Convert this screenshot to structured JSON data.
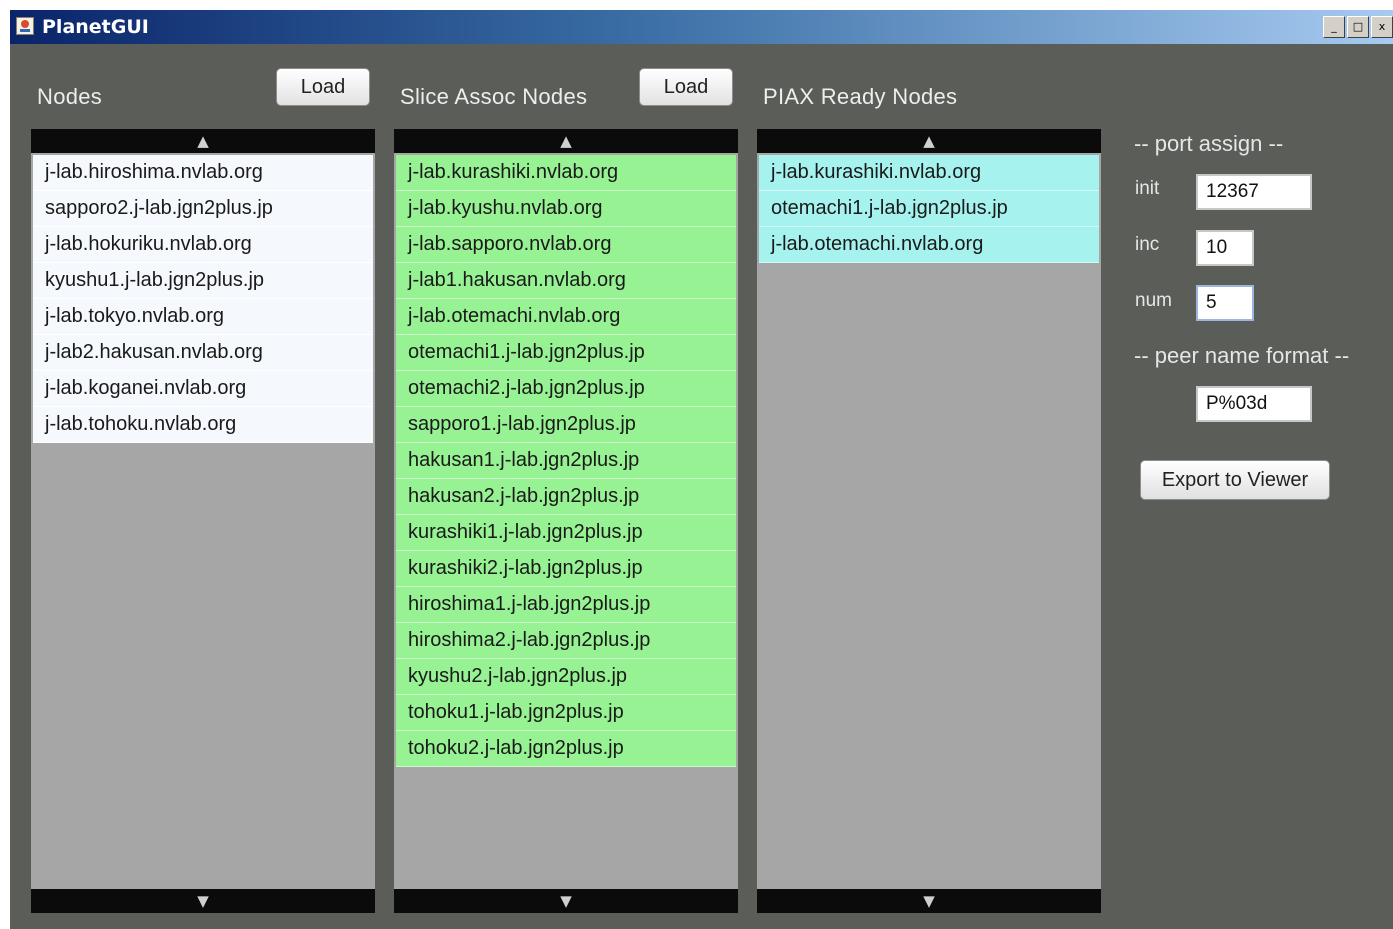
{
  "window": {
    "title": "PlanetGUI",
    "controls": [
      "_",
      "□",
      "x"
    ]
  },
  "nodes": {
    "label": "Nodes",
    "load_label": "Load",
    "items": [
      "j-lab.hiroshima.nvlab.org",
      "sapporo2.j-lab.jgn2plus.jp",
      "j-lab.hokuriku.nvlab.org",
      "kyushu1.j-lab.jgn2plus.jp",
      "j-lab.tokyo.nvlab.org",
      "j-lab2.hakusan.nvlab.org",
      "j-lab.koganei.nvlab.org",
      "j-lab.tohoku.nvlab.org"
    ]
  },
  "slice": {
    "label": "Slice Assoc Nodes",
    "load_label": "Load",
    "items": [
      "j-lab.kurashiki.nvlab.org",
      "j-lab.kyushu.nvlab.org",
      "j-lab.sapporo.nvlab.org",
      "j-lab1.hakusan.nvlab.org",
      "j-lab.otemachi.nvlab.org",
      "otemachi1.j-lab.jgn2plus.jp",
      "otemachi2.j-lab.jgn2plus.jp",
      "sapporo1.j-lab.jgn2plus.jp",
      "hakusan1.j-lab.jgn2plus.jp",
      "hakusan2.j-lab.jgn2plus.jp",
      "kurashiki1.j-lab.jgn2plus.jp",
      "kurashiki2.j-lab.jgn2plus.jp",
      "hiroshima1.j-lab.jgn2plus.jp",
      "hiroshima2.j-lab.jgn2plus.jp",
      "kyushu2.j-lab.jgn2plus.jp",
      "tohoku1.j-lab.jgn2plus.jp",
      "tohoku2.j-lab.jgn2plus.jp"
    ]
  },
  "piax": {
    "label": "PIAX Ready Nodes",
    "items": [
      "j-lab.kurashiki.nvlab.org",
      "otemachi1.j-lab.jgn2plus.jp",
      "j-lab.otemachi.nvlab.org"
    ]
  },
  "scroll": {
    "up": "▲",
    "down": "▼"
  },
  "port_assign": {
    "heading": "-- port assign --",
    "init_label": "init",
    "init_value": "12367",
    "inc_label": "inc",
    "inc_value": "10",
    "num_label": "num",
    "num_value": "5"
  },
  "peer_name": {
    "heading": "-- peer name format --",
    "value": "P%03d"
  },
  "export_label": "Export to Viewer"
}
